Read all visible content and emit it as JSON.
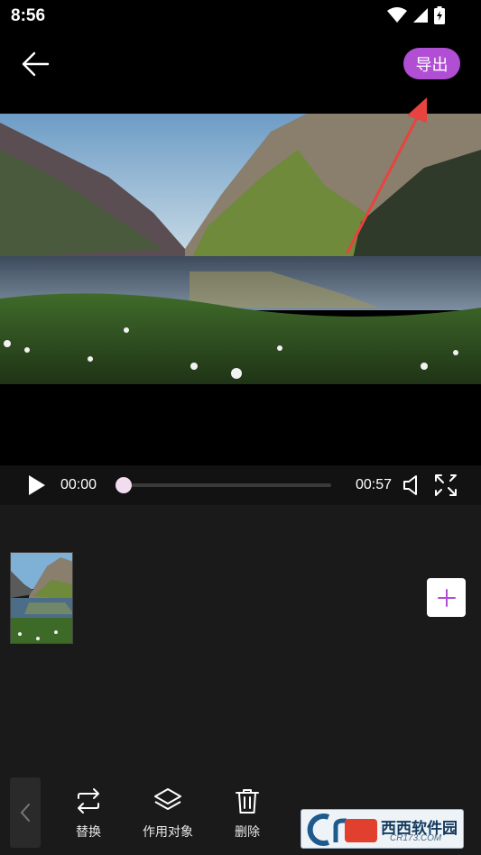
{
  "status_bar": {
    "time": "8:56",
    "icons": [
      "wifi-icon",
      "cellular-signal-icon",
      "battery-charging-icon"
    ]
  },
  "header": {
    "back_icon": "arrow-left-icon",
    "export_label": "导出",
    "accent_color": "#b04fd3"
  },
  "player": {
    "current_time": "00:00",
    "total_time": "00:57",
    "progress": 0,
    "play_icon": "play-icon",
    "volume_icon": "volume-icon",
    "fullscreen_icon": "fullscreen-icon"
  },
  "timeline": {
    "clips": [
      {
        "thumbnail": "lake-landscape"
      }
    ],
    "add_icon": "plus-icon"
  },
  "toolbar": {
    "collapse_icon": "chevron-left-icon",
    "items": [
      {
        "label": "替换",
        "icon": "replace-icon"
      },
      {
        "label": "作用对象",
        "icon": "layers-icon"
      },
      {
        "label": "删除",
        "icon": "trash-icon"
      }
    ]
  },
  "watermark": {
    "brand": "西西软件园",
    "domain": "CR173.COM"
  }
}
